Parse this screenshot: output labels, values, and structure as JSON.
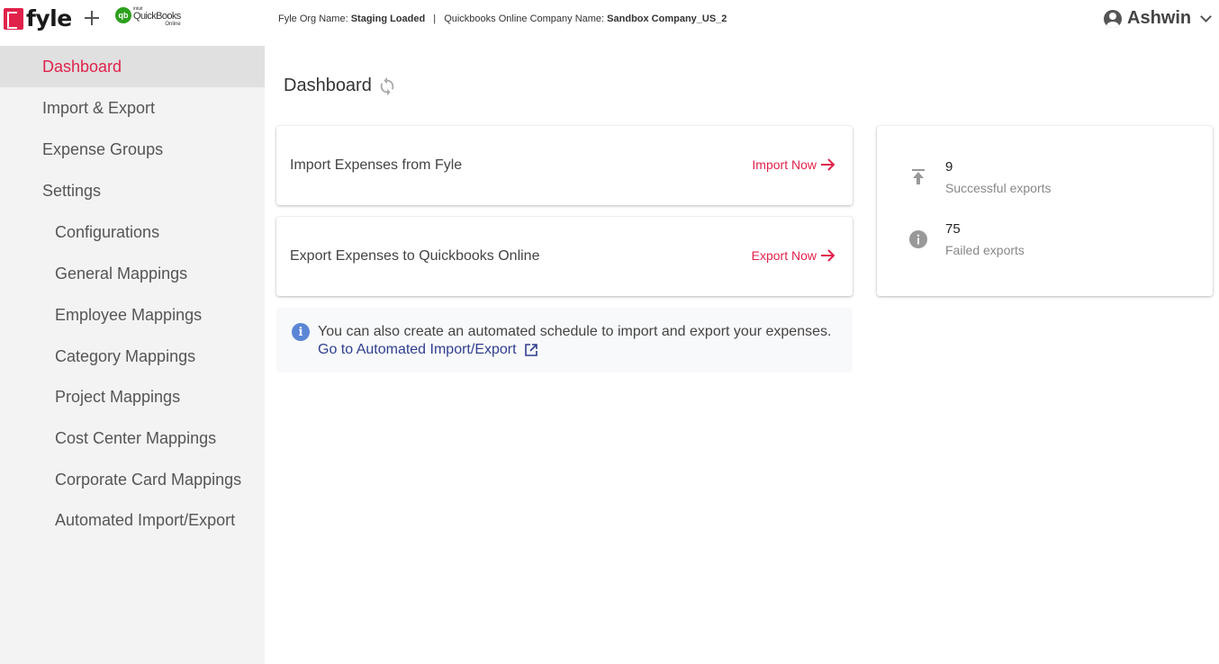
{
  "header": {
    "logo_text": "fyle",
    "qb_logo": {
      "intuit": "intuit",
      "name": "QuickBooks",
      "online": "Online",
      "badge": "qb"
    },
    "org_label": "Fyle Org Name:",
    "org_value": "Staging Loaded",
    "separator": "|",
    "company_label": "Quickbooks Online Company Name:",
    "company_value": "Sandbox Company_US_2",
    "user_name": "Ashwin"
  },
  "sidebar": {
    "items": [
      {
        "label": "Dashboard",
        "level": "top",
        "active": true
      },
      {
        "label": "Import & Export",
        "level": "top",
        "active": false
      },
      {
        "label": "Expense Groups",
        "level": "top",
        "active": false
      },
      {
        "label": "Settings",
        "level": "top",
        "active": false
      },
      {
        "label": "Configurations",
        "level": "sub",
        "active": false
      },
      {
        "label": "General Mappings",
        "level": "sub",
        "active": false
      },
      {
        "label": "Employee Mappings",
        "level": "sub",
        "active": false
      },
      {
        "label": "Category Mappings",
        "level": "sub",
        "active": false
      },
      {
        "label": "Project Mappings",
        "level": "sub",
        "active": false
      },
      {
        "label": "Cost Center Mappings",
        "level": "sub",
        "active": false
      },
      {
        "label": "Corporate Card Mappings",
        "level": "sub",
        "active": false
      },
      {
        "label": "Automated Import/Export",
        "level": "sub",
        "active": false
      }
    ]
  },
  "main": {
    "title": "Dashboard",
    "import_card": {
      "title": "Import Expenses from Fyle",
      "action": "Import Now"
    },
    "export_card": {
      "title": "Export Expenses to Quickbooks Online",
      "action": "Export Now"
    },
    "stats": {
      "successful": {
        "value": "9",
        "label": "Successful exports"
      },
      "failed": {
        "value": "75",
        "label": "Failed exports"
      }
    },
    "info": {
      "text": "You can also create an automated schedule to import and export your expenses.",
      "link": "Go to Automated Import/Export"
    }
  },
  "colors": {
    "accent": "#e0224b",
    "sidebar_bg": "#f3f3f3",
    "active_bg": "#e0e0e0",
    "link": "#2f3f8f",
    "info_icon": "#5b86d6"
  },
  "icons": [
    "plus-icon",
    "user-icon",
    "chevron-down-icon",
    "refresh-icon",
    "arrow-right-icon",
    "upload-icon",
    "info-icon",
    "external-link-icon"
  ]
}
